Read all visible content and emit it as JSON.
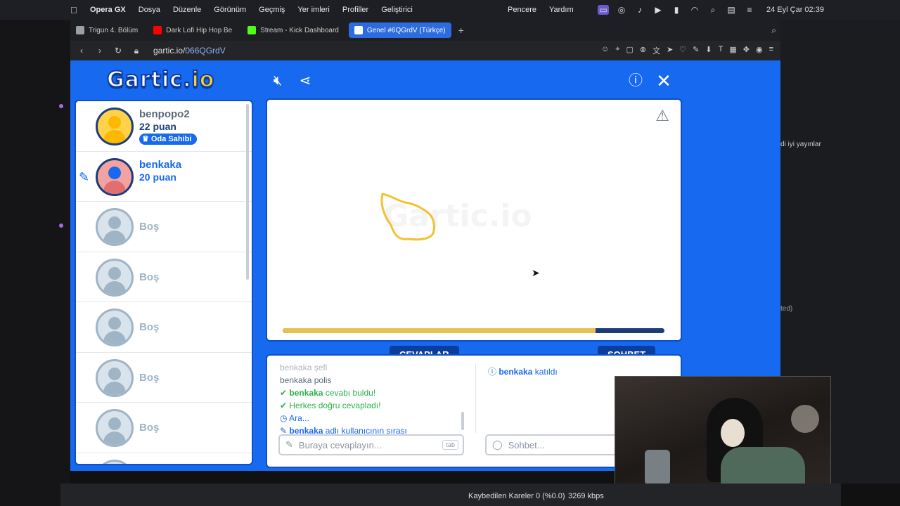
{
  "menubar": {
    "items": [
      "Opera GX",
      "Dosya",
      "Düzenle",
      "Görünüm",
      "Geçmiş",
      "Yer imleri",
      "Profiller",
      "Geliştirici"
    ],
    "right_items": [
      "Pencere",
      "Yardım"
    ],
    "clock": "24 Eyl Çar  02:39"
  },
  "tabs": [
    {
      "label": "Trigun 4. Bölüm",
      "color": "#9aa0a6"
    },
    {
      "label": "Dark Lofi Hip Hop Be",
      "color": "#ff0000"
    },
    {
      "label": "Stream - Kick Dashboard",
      "color": "#53fc18"
    },
    {
      "label": "Genel #6QGrdV (Türkçe)",
      "color": "#1769f0",
      "active": true
    }
  ],
  "address": {
    "host": "gartic.io/",
    "path": "066QGrdV"
  },
  "game": {
    "logo_main": "Gartic.",
    "logo_io": "io",
    "players": [
      {
        "name": "benpopo2",
        "score": "22 puan",
        "badge": "Oda Sahibi"
      },
      {
        "name": "benkaka",
        "score": "20 puan",
        "drawing": true
      }
    ],
    "empty_label": "Boş",
    "canvas": {
      "progress": 0.82,
      "watermark": "Gartic.io"
    },
    "tabs": {
      "answers": "CEVAPLAR",
      "chat": "SOHBET"
    },
    "answers": [
      {
        "type": "faded",
        "user": "benkaka",
        "text": "şefi"
      },
      {
        "type": "plain",
        "user": "benkaka",
        "text": "polis"
      },
      {
        "type": "correct",
        "user": "benkaka",
        "text": "cevabı buldu!"
      },
      {
        "type": "all",
        "text": "Herkes doğru cevapladı!"
      },
      {
        "type": "break",
        "text": "Ara..."
      },
      {
        "type": "turn",
        "user": "benkaka",
        "text": "adlı kullanıcının sırası"
      }
    ],
    "chat": [
      {
        "user": "benkaka",
        "text": "katıldı"
      }
    ],
    "answer_placeholder": "Buraya cevaplayın...",
    "answer_key": "tab",
    "chat_placeholder": "Sohbet..."
  },
  "right_panel": {
    "line1": "di iyi yayınlar",
    "line2": "ted)"
  },
  "obs": {
    "dropped": "Kaybedilen Kareler 0 (%0.0)",
    "bitrate": "3269 kbps"
  }
}
